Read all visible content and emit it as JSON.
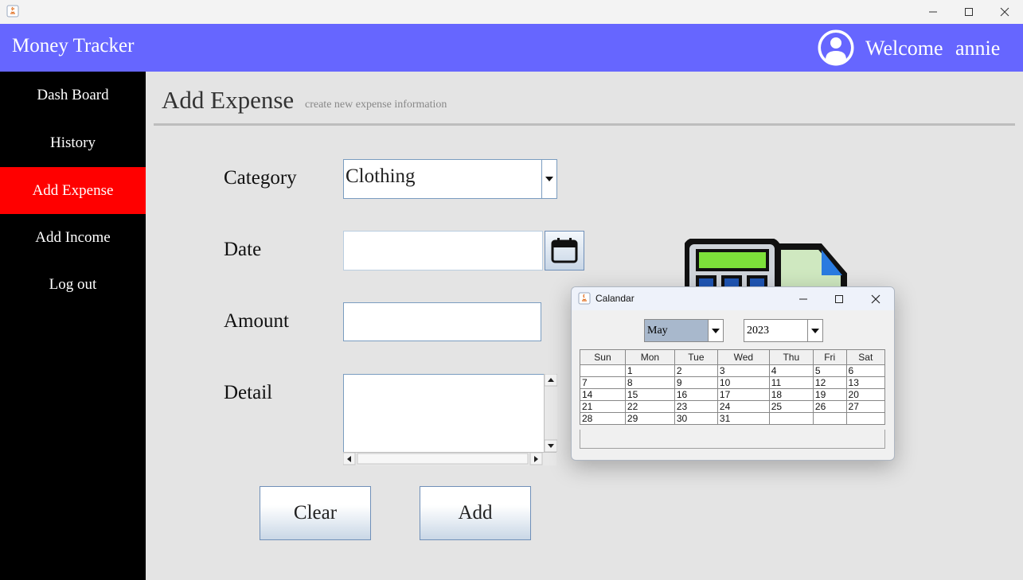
{
  "app": {
    "title": "Money Tracker",
    "welcome": "Welcome",
    "username": "annie"
  },
  "sidebar": {
    "items": [
      {
        "label": "Dash Board",
        "active": false
      },
      {
        "label": "History",
        "active": false
      },
      {
        "label": "Add Expense",
        "active": true
      },
      {
        "label": "Add Income",
        "active": false
      },
      {
        "label": "Log out",
        "active": false
      }
    ]
  },
  "page": {
    "title": "Add Expense",
    "subtitle": "create new expense information"
  },
  "form": {
    "category_label": "Category",
    "category_value": "Clothing",
    "date_label": "Date",
    "date_value": "",
    "amount_label": "Amount",
    "amount_value": "",
    "detail_label": "Detail",
    "detail_value": ""
  },
  "buttons": {
    "clear": "Clear",
    "add": "Add"
  },
  "calendar": {
    "title": "Calandar",
    "month": "May",
    "year": "2023",
    "weekdays": [
      "Sun",
      "Mon",
      "Tue",
      "Wed",
      "Thu",
      "Fri",
      "Sat"
    ],
    "weeks": [
      [
        "",
        "1",
        "2",
        "3",
        "4",
        "5",
        "6"
      ],
      [
        "7",
        "8",
        "9",
        "10",
        "11",
        "12",
        "13"
      ],
      [
        "14",
        "15",
        "16",
        "17",
        "18",
        "19",
        "20"
      ],
      [
        "21",
        "22",
        "23",
        "24",
        "25",
        "26",
        "27"
      ],
      [
        "28",
        "29",
        "30",
        "31",
        "",
        "",
        ""
      ]
    ]
  },
  "colors": {
    "header": "#6666ff",
    "sidebar": "#000000",
    "active_nav": "#ff0000",
    "content_bg": "#e4e4e4"
  }
}
